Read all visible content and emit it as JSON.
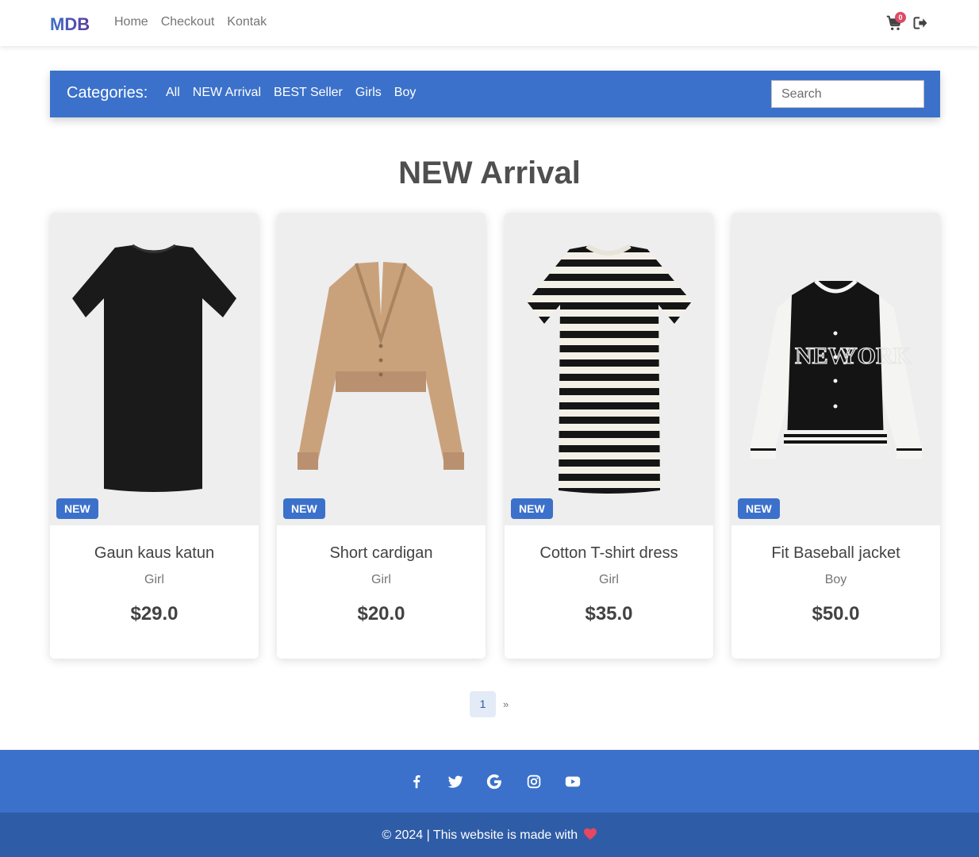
{
  "navbar": {
    "logo": "MDB",
    "links": [
      "Home",
      "Checkout",
      "Kontak"
    ],
    "cart_count": "0",
    "cart_icon": "shopping-cart-icon",
    "logout_icon": "sign-out-icon"
  },
  "categories": {
    "title": "Categories:",
    "links": [
      "All",
      "NEW Arrival",
      "BEST Seller",
      "Girls",
      "Boy"
    ],
    "search_placeholder": "Search"
  },
  "section": {
    "title": "NEW Arrival"
  },
  "products": [
    {
      "badge": "NEW",
      "name": "Gaun kaus katun",
      "category": "Girl",
      "price": "$29.0"
    },
    {
      "badge": "NEW",
      "name": "Short cardigan",
      "category": "Girl",
      "price": "$20.0"
    },
    {
      "badge": "NEW",
      "name": "Cotton T-shirt dress",
      "category": "Girl",
      "price": "$35.0"
    },
    {
      "badge": "NEW",
      "name": "Fit Baseball jacket",
      "category": "Boy",
      "price": "$50.0"
    }
  ],
  "pagination": {
    "current": "1",
    "next": "»"
  },
  "footer": {
    "social_icons": [
      "facebook-icon",
      "twitter-icon",
      "google-icon",
      "instagram-icon",
      "youtube-icon"
    ],
    "copyright": "© 2024 | This website is made with"
  },
  "colors": {
    "primary": "#3b71ca",
    "footer_dark": "#2f5ca6",
    "badge_red": "#dc4c64"
  }
}
